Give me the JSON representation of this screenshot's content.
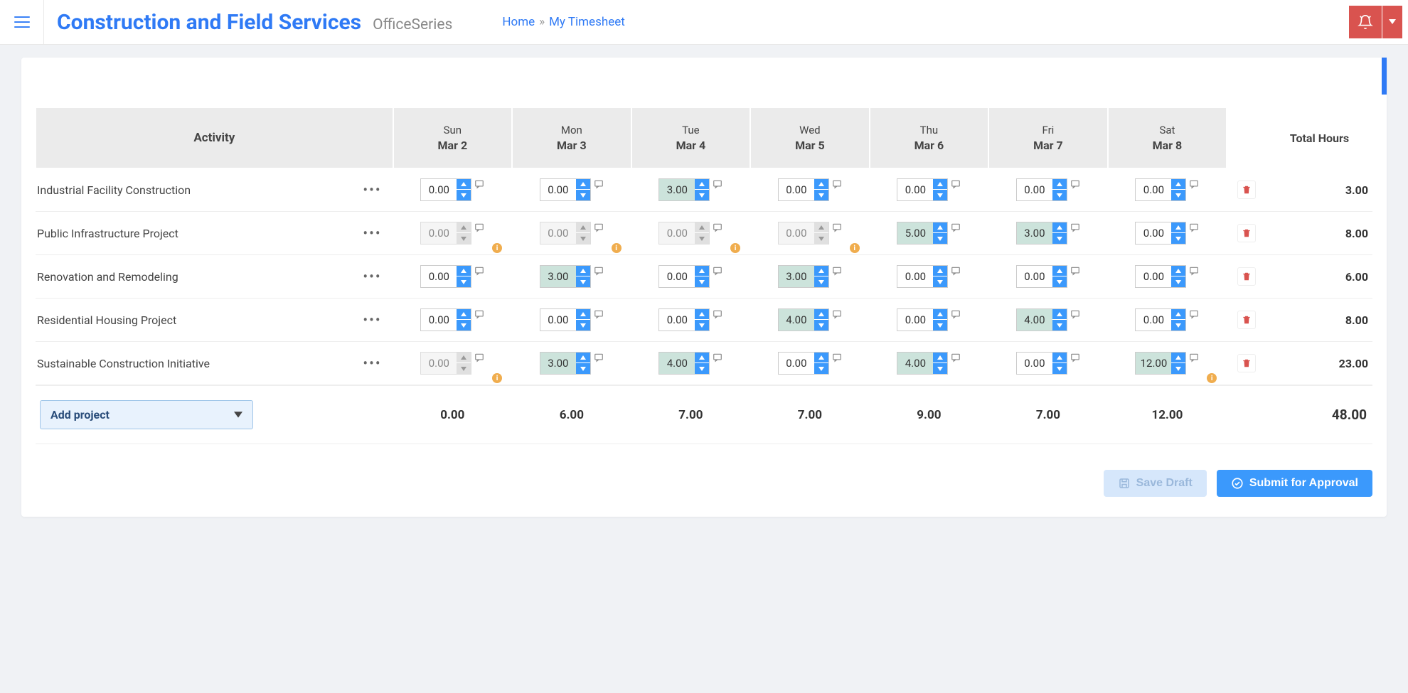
{
  "header": {
    "brand_title": "Construction and Field Services",
    "brand_sub": "OfficeSeries",
    "breadcrumb": {
      "home": "Home",
      "current": "My Timesheet"
    }
  },
  "table": {
    "activity_header": "Activity",
    "total_header": "Total Hours",
    "days": [
      {
        "dow": "Sun",
        "date": "Mar 2"
      },
      {
        "dow": "Mon",
        "date": "Mar 3"
      },
      {
        "dow": "Tue",
        "date": "Mar 4"
      },
      {
        "dow": "Wed",
        "date": "Mar 5"
      },
      {
        "dow": "Thu",
        "date": "Mar 6"
      },
      {
        "dow": "Fri",
        "date": "Mar 7"
      },
      {
        "dow": "Sat",
        "date": "Mar 8"
      }
    ],
    "rows": [
      {
        "activity": "Industrial Facility Construction",
        "cells": [
          {
            "value": "0.00",
            "filled": false,
            "disabled": false,
            "warn": false
          },
          {
            "value": "0.00",
            "filled": false,
            "disabled": false,
            "warn": false
          },
          {
            "value": "3.00",
            "filled": true,
            "disabled": false,
            "warn": false
          },
          {
            "value": "0.00",
            "filled": false,
            "disabled": false,
            "warn": false
          },
          {
            "value": "0.00",
            "filled": false,
            "disabled": false,
            "warn": false
          },
          {
            "value": "0.00",
            "filled": false,
            "disabled": false,
            "warn": false
          },
          {
            "value": "0.00",
            "filled": false,
            "disabled": false,
            "warn": false
          }
        ],
        "total": "3.00"
      },
      {
        "activity": "Public Infrastructure Project",
        "cells": [
          {
            "value": "0.00",
            "filled": false,
            "disabled": true,
            "warn": true
          },
          {
            "value": "0.00",
            "filled": false,
            "disabled": true,
            "warn": true
          },
          {
            "value": "0.00",
            "filled": false,
            "disabled": true,
            "warn": true
          },
          {
            "value": "0.00",
            "filled": false,
            "disabled": true,
            "warn": true
          },
          {
            "value": "5.00",
            "filled": true,
            "disabled": false,
            "warn": false
          },
          {
            "value": "3.00",
            "filled": true,
            "disabled": false,
            "warn": false
          },
          {
            "value": "0.00",
            "filled": false,
            "disabled": false,
            "warn": false
          }
        ],
        "total": "8.00"
      },
      {
        "activity": "Renovation and Remodeling",
        "cells": [
          {
            "value": "0.00",
            "filled": false,
            "disabled": false,
            "warn": false
          },
          {
            "value": "3.00",
            "filled": true,
            "disabled": false,
            "warn": false
          },
          {
            "value": "0.00",
            "filled": false,
            "disabled": false,
            "warn": false
          },
          {
            "value": "3.00",
            "filled": true,
            "disabled": false,
            "warn": false
          },
          {
            "value": "0.00",
            "filled": false,
            "disabled": false,
            "warn": false
          },
          {
            "value": "0.00",
            "filled": false,
            "disabled": false,
            "warn": false
          },
          {
            "value": "0.00",
            "filled": false,
            "disabled": false,
            "warn": false
          }
        ],
        "total": "6.00"
      },
      {
        "activity": "Residential Housing Project",
        "cells": [
          {
            "value": "0.00",
            "filled": false,
            "disabled": false,
            "warn": false
          },
          {
            "value": "0.00",
            "filled": false,
            "disabled": false,
            "warn": false
          },
          {
            "value": "0.00",
            "filled": false,
            "disabled": false,
            "warn": false
          },
          {
            "value": "4.00",
            "filled": true,
            "disabled": false,
            "warn": false
          },
          {
            "value": "0.00",
            "filled": false,
            "disabled": false,
            "warn": false
          },
          {
            "value": "4.00",
            "filled": true,
            "disabled": false,
            "warn": false
          },
          {
            "value": "0.00",
            "filled": false,
            "disabled": false,
            "warn": false
          }
        ],
        "total": "8.00"
      },
      {
        "activity": "Sustainable Construction Initiative",
        "cells": [
          {
            "value": "0.00",
            "filled": false,
            "disabled": true,
            "warn": true
          },
          {
            "value": "3.00",
            "filled": true,
            "disabled": false,
            "warn": false
          },
          {
            "value": "4.00",
            "filled": true,
            "disabled": false,
            "warn": false
          },
          {
            "value": "0.00",
            "filled": false,
            "disabled": false,
            "warn": false
          },
          {
            "value": "4.00",
            "filled": true,
            "disabled": false,
            "warn": false
          },
          {
            "value": "0.00",
            "filled": false,
            "disabled": false,
            "warn": false
          },
          {
            "value": "12.00",
            "filled": true,
            "disabled": false,
            "warn": true
          }
        ],
        "total": "23.00"
      }
    ],
    "column_totals": [
      "0.00",
      "6.00",
      "7.00",
      "7.00",
      "9.00",
      "7.00",
      "12.00"
    ],
    "grand_total": "48.00",
    "add_project_label": "Add project"
  },
  "actions": {
    "save_draft": "Save Draft",
    "submit": "Submit for Approval"
  }
}
